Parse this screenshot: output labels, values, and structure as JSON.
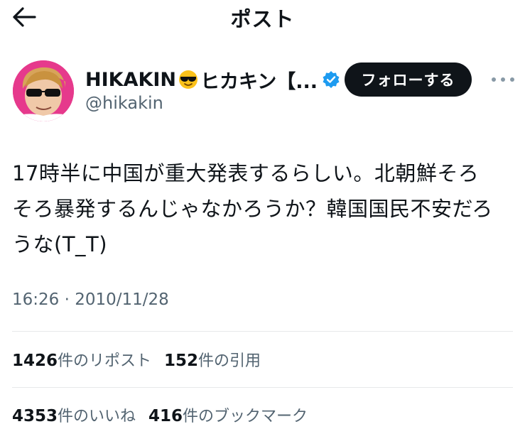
{
  "header": {
    "title": "ポスト"
  },
  "user": {
    "display_name": "HIKAKIN",
    "display_name_suffix": "ヒカキン【...",
    "handle": "@hikakin",
    "follow_label": "フォローする"
  },
  "tweet": {
    "lines": [
      "17時半に中国が重大発表するらしい。北朝鮮そろ",
      "そろ暴発するんじゃなかろうか？韓国国民不安だろ",
      "うな(T_T)"
    ],
    "timestamp": "16:26 · 2010/11/28"
  },
  "stats": {
    "reposts_count": "1426",
    "reposts_label": "件のリポスト",
    "quotes_count": "152",
    "quotes_label": "件の引用",
    "likes_count": "4353",
    "likes_label": "件のいいね",
    "bookmarks_count": "416",
    "bookmarks_label": "件のブックマーク"
  },
  "colors": {
    "text": "#0f1419",
    "secondary": "#536471",
    "follow_bg": "#0f1419",
    "verified": "#1d9bf0",
    "avatar_bg": "#e6398c"
  },
  "icons": {
    "back": "arrow-left-icon",
    "verified": "verified-badge-icon",
    "more": "more-horizontal-icon",
    "emoji": "sunglasses-emoji-icon"
  }
}
